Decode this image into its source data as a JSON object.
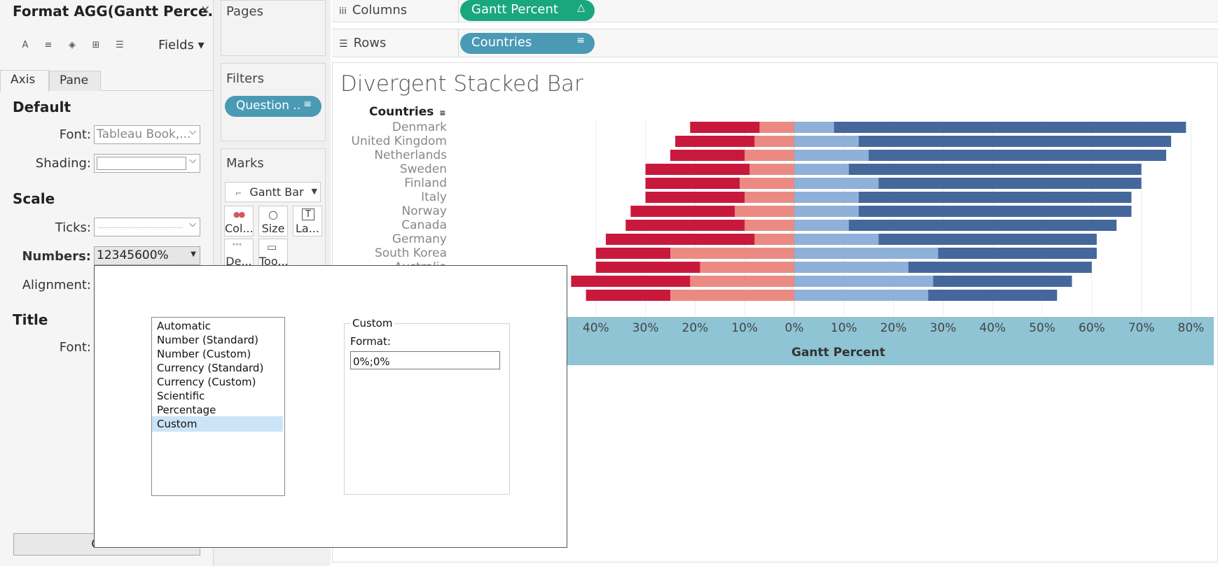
{
  "format_pane": {
    "title": "Format AGG(Gantt Perce...",
    "close": "×",
    "toolbar": {
      "font_icon": "A",
      "align_icon": "≡",
      "shading_icon": "◈",
      "borders_icon": "⊞",
      "lines_icon": "☰",
      "fields_label": "Fields ▾"
    },
    "tabs": [
      "Axis",
      "Pane"
    ],
    "default_section": "Default",
    "font_label": "Font:",
    "font_value": "Tableau Book,...",
    "shading_label": "Shading:",
    "scale_section": "Scale",
    "ticks_label": "Ticks:",
    "numbers_label": "Numbers:",
    "numbers_value": "12345600%",
    "alignment_label": "Alignment:",
    "title_section": "Title",
    "title_font_label": "Font:",
    "clear_label": "Clear"
  },
  "shelves": {
    "pages_title": "Pages",
    "filters_title": "Filters",
    "filter_pill": "Question ..",
    "marks_title": "Marks",
    "mark_type": "Gantt Bar",
    "mark_buttons": [
      "Col...",
      "Size",
      "La...",
      "De...",
      "Too..."
    ],
    "columns_label": "Columns",
    "columns_pill": "Gantt Percent",
    "rows_label": "Rows",
    "rows_pill": "Countries"
  },
  "view": {
    "title": "Divergent Stacked Bar",
    "row_header": "Countries",
    "axis_title": "Gantt Percent"
  },
  "chart_data": {
    "type": "bar",
    "categories": [
      "Denmark",
      "United Kingdom",
      "Netherlands",
      "Sweden",
      "Finland",
      "Italy",
      "Norway",
      "Canada",
      "Germany",
      "South Korea",
      "Australia",
      "",
      ""
    ],
    "series": [
      {
        "name": "",
        "color": "#c8193c",
        "values": [
          -14,
          -16,
          -15,
          -21,
          -19,
          -20,
          -21,
          -24,
          -30,
          -15,
          -21,
          -24,
          -17
        ]
      },
      {
        "name": "",
        "color": "#eb8a82",
        "values": [
          -7,
          -8,
          -10,
          -9,
          -11,
          -10,
          -12,
          -10,
          -8,
          -25,
          -19,
          -21,
          -25
        ]
      },
      {
        "name": "",
        "color": "#8fb0d8",
        "values": [
          8,
          13,
          15,
          11,
          17,
          13,
          13,
          11,
          17,
          29,
          23,
          28,
          27
        ]
      },
      {
        "name": "",
        "color": "#44689b",
        "values": [
          71,
          63,
          60,
          59,
          53,
          55,
          55,
          54,
          44,
          32,
          37,
          28,
          26
        ]
      }
    ],
    "xlim": [
      -60,
      80
    ],
    "x_ticks": [
      "40%",
      "30%",
      "20%",
      "10%",
      "0%",
      "10%",
      "20%",
      "30%",
      "40%",
      "50%",
      "60%",
      "70%",
      "80%"
    ],
    "x_tick_values": [
      -40,
      -30,
      -20,
      -10,
      0,
      10,
      20,
      30,
      40,
      50,
      60,
      70,
      80
    ],
    "xlabel": "Gantt Percent",
    "grid": true
  },
  "dialog": {
    "format_types": [
      "Automatic",
      "Number (Standard)",
      "Number (Custom)",
      "Currency (Standard)",
      "Currency (Custom)",
      "Scientific",
      "Percentage",
      "Custom"
    ],
    "selected": "Custom",
    "custom_group": "Custom",
    "format_label": "Format:",
    "format_value": "0%;0%"
  }
}
